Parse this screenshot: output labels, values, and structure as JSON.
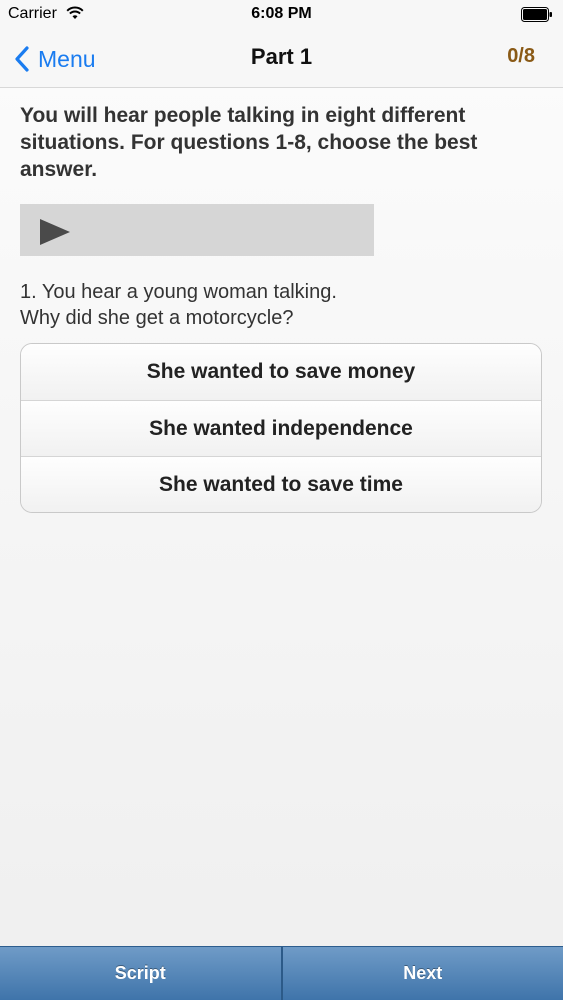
{
  "status_bar": {
    "carrier": "Carrier",
    "time": "6:08 PM",
    "icons": [
      "wifi-icon",
      "battery-icon"
    ]
  },
  "nav": {
    "back_label": "Menu",
    "title": "Part 1",
    "score": "0/8",
    "colors": {
      "back": "#1a7cf0",
      "score": "#8a5a16"
    }
  },
  "content": {
    "instructions": "You will hear people talking in eight different situations. For questions 1-8, choose the best answer.",
    "audio": {
      "icon": "play-icon"
    },
    "question_line1": "1. You hear a young woman talking.",
    "question_line2": "Why did she get a motorcycle?",
    "answers": [
      "She wanted to save money",
      "She wanted independence",
      "She wanted to save time"
    ]
  },
  "toolbar": {
    "script_label": "Script",
    "next_label": "Next",
    "color": "#4f80b4"
  }
}
